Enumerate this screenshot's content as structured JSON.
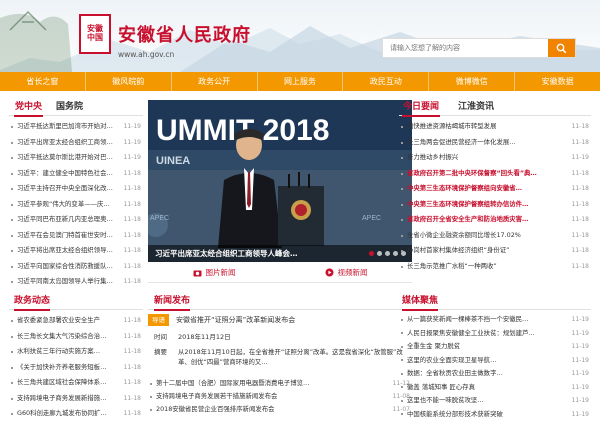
{
  "header": {
    "emblem_line1": "安徽",
    "emblem_line2": "中国",
    "site_title": "安徽省人民政府",
    "site_url": "www.ah.gov.cn",
    "search_placeholder": "请输入您想了解的内容"
  },
  "nav": [
    "省长之窗",
    "徽风皖韵",
    "政务公开",
    "网上服务",
    "政民互动",
    "微博微信",
    "安徽数据"
  ],
  "left_tabs": {
    "active": "党中央",
    "inactive": "国务院"
  },
  "left_list": [
    {
      "title": "习近平抵达斯里巴加湾市开始对…",
      "date": "11-19"
    },
    {
      "title": "习近平出席亚太经合组织工商领…",
      "date": "11-19"
    },
    {
      "title": "习近平抵达莫尔斯比港开始对巴…",
      "date": "11-19"
    },
    {
      "title": "习近平：建立健全中国特色社会…",
      "date": "11-18"
    },
    {
      "title": "习近平主持召开中央全面深化改…",
      "date": "11-18"
    },
    {
      "title": "习近平参观“伟大的变革——庆…",
      "date": "11-18"
    },
    {
      "title": "习近平同巴布亚新几内亚总理奥…",
      "date": "11-18"
    },
    {
      "title": "习近平在会见澳门特首崔世安时…",
      "date": "11-18"
    },
    {
      "title": "习近平将出席亚太经合组织领导…",
      "date": "11-18"
    },
    {
      "title": "习近平向国家综合性消防救援队…",
      "date": "11-18"
    },
    {
      "title": "习近平同南太岛国领导人举行集…",
      "date": "11-18"
    }
  ],
  "carousel": {
    "caption": "习近平出席亚太经合组织工商领导人峰会…",
    "active_dot": 0,
    "dot_count": 5
  },
  "photo_labels": {
    "pic": "图片新闻",
    "video": "视频新闻"
  },
  "right_tabs": {
    "active": "今日要闻",
    "inactive": "江淮资讯"
  },
  "right_list": [
    {
      "title": "加快推进资源枯竭城市转型发展",
      "date": "11-18",
      "red": false
    },
    {
      "title": "长三角两会促进民营经济一体化发展…",
      "date": "11-18",
      "red": false
    },
    {
      "title": "奋力推动乡村振兴",
      "date": "11-19",
      "red": false
    },
    {
      "title": "省政府召开第二批中央环保督察“回头看”典…",
      "date": "11-18",
      "red": true
    },
    {
      "title": "中央第三生态环境保护督察组向安徽省…",
      "date": "11-18",
      "red": true
    },
    {
      "title": "中央第三生态环境保护督察组转办信访件…",
      "date": "11-18",
      "red": true
    },
    {
      "title": "省政府召开全省安全生产和防治地质灾害…",
      "date": "11-18",
      "red": true
    },
    {
      "title": "全省小微企业融资余额同比增长17.02%",
      "date": "11-18",
      "red": false
    },
    {
      "title": "小岗村首家村集体经济组织“身份证”",
      "date": "11-18",
      "red": false
    },
    {
      "title": "长三角示范推广水稻“一种两收”",
      "date": "11-18",
      "red": false
    }
  ],
  "news_dynamics": {
    "title": "政务动态",
    "items": [
      {
        "title": "省农委紧急部署农业安全生产",
        "date": "11-18"
      },
      {
        "title": "长三角长文集大气污染综合治…",
        "date": "11-18"
      },
      {
        "title": "水利扶贫三年行动实施方案…",
        "date": "11-18"
      },
      {
        "title": "《关于加快补齐养老服务短板…",
        "date": "11-18"
      },
      {
        "title": "长三角共建区域社会保障体系…",
        "date": "11-18"
      },
      {
        "title": "支持跨境电子商务发展新措施…",
        "date": "11-18"
      },
      {
        "title": "G60科创走廊九城发布协同扩…",
        "date": "11-18"
      }
    ]
  },
  "news_release": {
    "title": "新闻发布",
    "badge": "导语",
    "headline": "安徽省推开“证照分离”改革新闻发布会",
    "time_label": "时间",
    "time": "2018年11月12日",
    "summary_label": "摘要",
    "summary": "从2018年11月10日起，在全省推开“证照分离”改革。这是我省深化“放管服”改革、创优“四最”营商环境的又…",
    "items": [
      {
        "title": "第十二届中国（合肥）国际家用电器暨消费电子博览…",
        "date": "11-12"
      },
      {
        "title": "支持跨境电子商务发展若干措施新闻发布会",
        "date": "11-08"
      },
      {
        "title": "2018安徽省民营企业百强排序新闻发布会",
        "date": "11-07"
      }
    ]
  },
  "media_focus": {
    "title": "媒体聚焦",
    "items": [
      {
        "title": "从一篇获奖新闻一棵棒茶不挡一个安徽民…",
        "date": "11-19"
      },
      {
        "title": "人民日报聚焦安徽健全工业扶贫：规划建芦…",
        "date": "11-19"
      },
      {
        "title": "全重生金  聚力脱贫",
        "date": "11-19"
      },
      {
        "title": "这里的农业全面实现卫星导航…",
        "date": "11-19"
      },
      {
        "title": "数据：全省秋贡农业田主做数字…",
        "date": "11-19"
      },
      {
        "title": "徽盖  落城知事  匠心存真",
        "date": "11-19"
      },
      {
        "title": "这里也不能一味脱贫攻坚…",
        "date": "11-19"
      },
      {
        "title": "中国核能系统分部形技术获新突破",
        "date": "11-19"
      }
    ]
  }
}
